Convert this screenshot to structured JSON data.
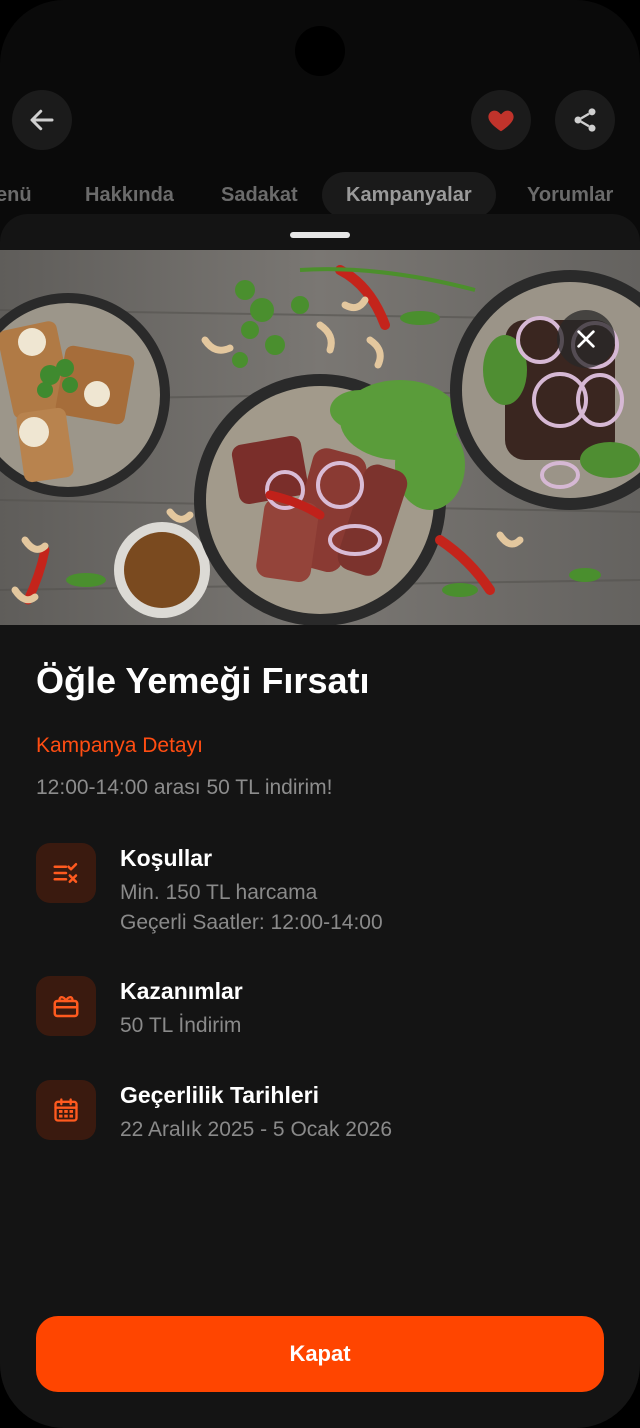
{
  "header": {
    "back_icon": "arrow-left-icon",
    "favorite_icon": "heart-icon",
    "share_icon": "share-icon",
    "accent": "#ff4500"
  },
  "tabs": [
    {
      "label": "Menü",
      "visible_label": "enü",
      "active": false
    },
    {
      "label": "Hakkında",
      "active": false
    },
    {
      "label": "Sadakat",
      "active": false
    },
    {
      "label": "Kampanyalar",
      "active": true
    },
    {
      "label": "Yorumlar",
      "active": false
    }
  ],
  "campaign": {
    "close_icon": "close-icon",
    "title": "Öğle Yemeği Fırsatı",
    "detail_label": "Kampanya Detayı",
    "description": "12:00-14:00 arası 50 TL indirim!",
    "sections": [
      {
        "icon": "checklist-icon",
        "title": "Koşullar",
        "lines": [
          "Min. 150 TL harcama",
          "Geçerli Saatler: 12:00-14:00"
        ]
      },
      {
        "icon": "gift-card-icon",
        "title": "Kazanımlar",
        "lines": [
          "50 TL İndirim"
        ]
      },
      {
        "icon": "calendar-icon",
        "title": "Geçerlilik Tarihleri",
        "lines": [
          "22 Aralık 2025 - 5 Ocak 2026"
        ]
      }
    ],
    "close_button_label": "Kapat"
  }
}
